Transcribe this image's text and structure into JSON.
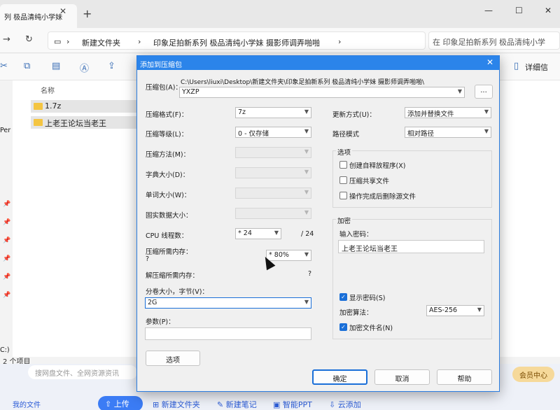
{
  "explorer": {
    "tab_title": "列 极品清纯小学妹",
    "breadcrumb": [
      "新建文件夹",
      "印象足拍新系列 极品清纯小学妹 摄影师调弄啪啪"
    ],
    "search_text": "在 印象足拍新系列 极品清纯小学",
    "details_label": "详细信",
    "column_name": "名称",
    "files": [
      "1.7z",
      "上老王论坛当老王"
    ],
    "status": "2 个项目",
    "side_text": [
      "Per",
      "C:)"
    ]
  },
  "netdisk": {
    "search_placeholder": "搜网盘文件、全网资源资讯",
    "vip_label": "会员中心",
    "my_files": "我的文件",
    "upload": "上传",
    "actions": [
      "新建文件夹",
      "新建笔记",
      "智能PPT",
      "云添加"
    ]
  },
  "dialog": {
    "title": "添加到压缩包",
    "archive_label": "压缩包(A)：",
    "archive_path": "C:\\Users\\liuxi\\Desktop\\新建文件夹\\印象足拍新系列 极品清纯小学妹 摄影师调弄啪啪\\",
    "archive_name": "YXZP",
    "browse_label": "...",
    "format_label": "压缩格式(F)：",
    "format_value": "7z",
    "level_label": "压缩等级(L)：",
    "level_value": "0 - 仅存储",
    "method_label": "压缩方法(M)：",
    "dict_label": "字典大小(D)：",
    "word_label": "单词大小(W)：",
    "solid_label": "固实数据大小：",
    "threads_label": "CPU 线程数：",
    "threads_value": "* 24",
    "threads_total": "/ 24",
    "mem_label": "压缩所需内存：",
    "mem_q": "?",
    "mem_value": "* 80%",
    "decomp_label": "解压缩所需内存：",
    "decomp_q": "?",
    "split_label": "分卷大小，字节(V)：",
    "split_value": "2G",
    "params_label": "参数(P)：",
    "options_button": "选项",
    "update_label": "更新方式(U)：",
    "update_value": "添加并替换文件",
    "path_label": "路径模式",
    "path_value": "相对路径",
    "options_group": "选项",
    "opt_sfx": "创建自释放程序(X)",
    "opt_shared": "压缩共享文件",
    "opt_delete": "操作完成后删除源文件",
    "encrypt_group": "加密",
    "password_label": "输入密码：",
    "password_value": "上老王论坛当老王",
    "show_password": "显示密码(S)",
    "enc_method_label": "加密算法：",
    "enc_method_value": "AES-256",
    "encrypt_names": "加密文件名(N)",
    "ok": "确定",
    "cancel": "取消",
    "help": "帮助"
  }
}
